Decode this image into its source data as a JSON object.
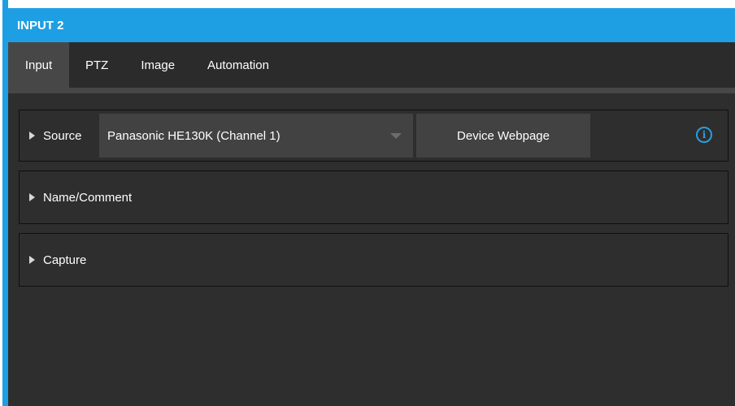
{
  "window": {
    "title": "INPUT 2"
  },
  "tabs": [
    {
      "label": "Input",
      "active": true
    },
    {
      "label": "PTZ",
      "active": false
    },
    {
      "label": "Image",
      "active": false
    },
    {
      "label": "Automation",
      "active": false
    }
  ],
  "sections": {
    "source": {
      "label": "Source",
      "selected_value": "Panasonic HE130K (Channel 1)",
      "device_webpage_label": "Device Webpage",
      "info_icon": "info-icon"
    },
    "name_comment": {
      "label": "Name/Comment"
    },
    "capture": {
      "label": "Capture"
    }
  },
  "colors": {
    "accent": "#1e9fe3",
    "background": "#2e2e2e",
    "control": "#424242",
    "info": "#2a9de0"
  }
}
